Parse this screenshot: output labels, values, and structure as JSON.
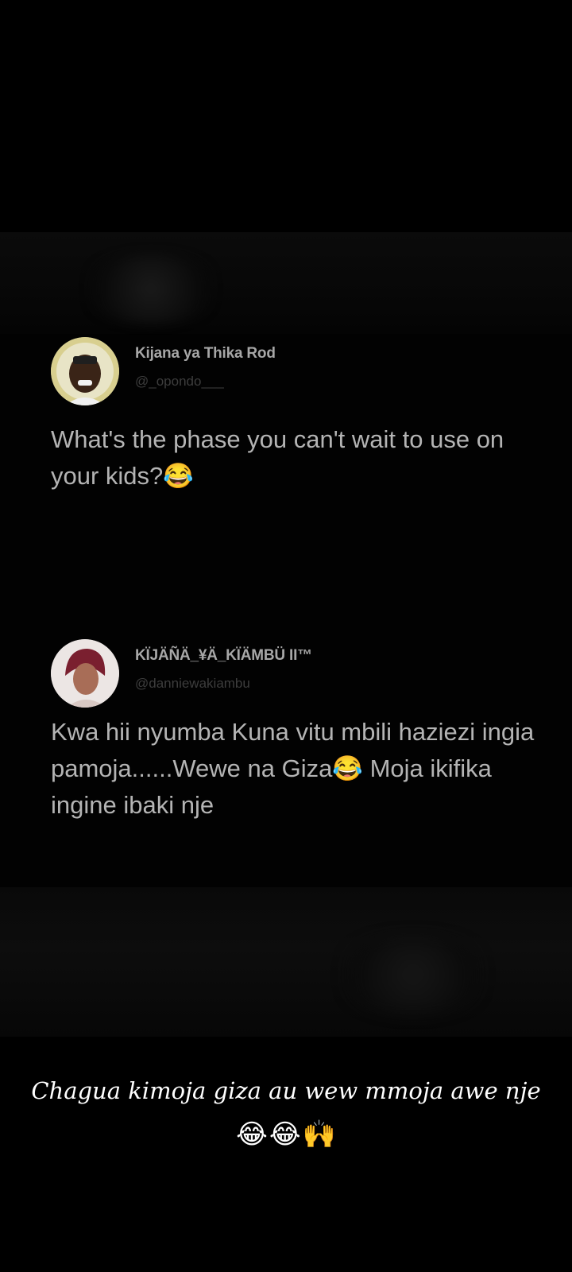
{
  "tweets": [
    {
      "display_name": "Kijana ya Thika Rod",
      "handle": "@_opondo___",
      "text": "What's the phase you can't wait to use on your kids?😂"
    },
    {
      "display_name": "KÏJÄÑÄ_¥Ä_KÏÄMBÜ II™",
      "handle": "@danniewakiambu",
      "text": "Kwa hii nyumba Kuna vitu mbili haziezi ingia pamoja......Wewe na Giza😂 Moja ikifika ingine ibaki nje"
    }
  ],
  "caption": {
    "text": "Chagua kimoja giza au wew mmoja awe nje",
    "emojis": [
      "😂",
      "😂",
      "🙌"
    ]
  },
  "colors": {
    "background": "#000000",
    "tweet_text": "#b4b4b4",
    "caption_text": "#ffffff"
  }
}
